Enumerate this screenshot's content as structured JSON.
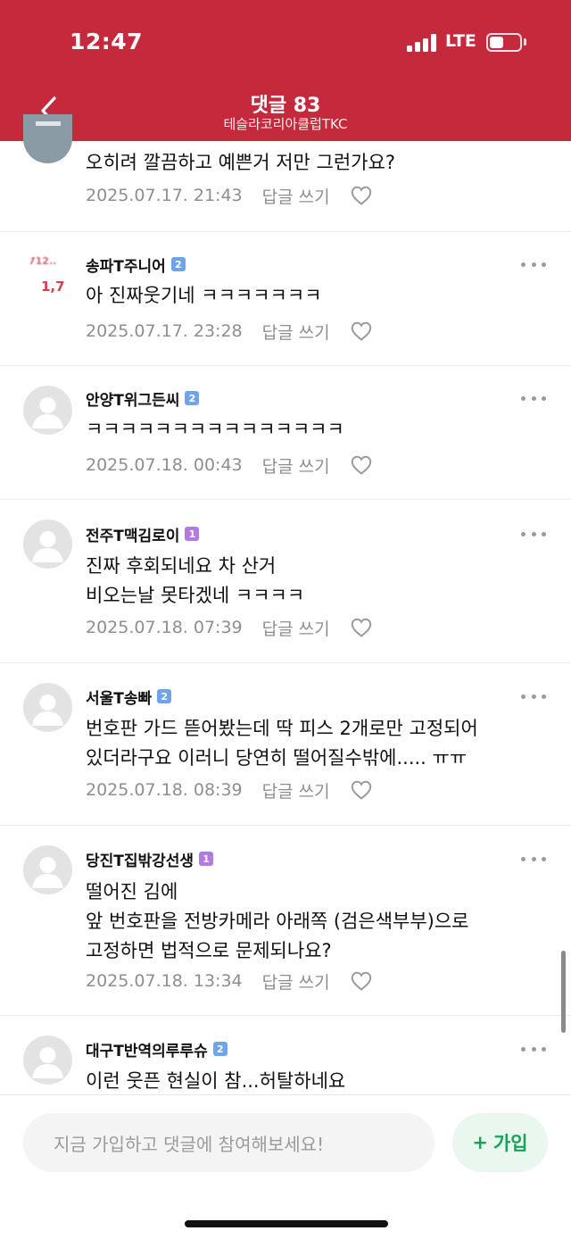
{
  "status_bar": {
    "time": "12:47",
    "network": "LTE"
  },
  "header": {
    "title": "댓글 83",
    "subtitle": "테슬라코리아클럽TKC"
  },
  "comments": [
    {
      "text": "오히려 깔끔하고 예쁜거 저만 그런가요?",
      "date": "2025.07.17. 21:43",
      "reply_label": "답글 쓰기"
    },
    {
      "author": "송파T주니어",
      "level": "2",
      "text": "아 진짜웃기네 ㅋㅋㅋㅋㅋㅋㅋ",
      "date": "2025.07.17. 23:28",
      "reply_label": "답글 쓰기",
      "avatar_text_1": "712..",
      "avatar_text_2": "1,7"
    },
    {
      "author": "안양T위그든씨",
      "level": "2",
      "text": "ㅋㅋㅋㅋㅋㅋㅋㅋㅋㅋㅋㅋㅋㅋㅋ",
      "date": "2025.07.18. 00:43",
      "reply_label": "답글 쓰기"
    },
    {
      "author": "전주T맥김로이",
      "level": "1",
      "text": "진짜 후회되네요 차 산거\n비오는날 못타겠네 ㅋㅋㅋㅋ",
      "date": "2025.07.18. 07:39",
      "reply_label": "답글 쓰기"
    },
    {
      "author": "서울T송빠",
      "level": "2",
      "text": "번호판 가드 뜯어봤는데 딱 피스 2개로만 고정되어\n있더라구요 이러니 당연히 떨어질수밖에..... ㅠㅠ",
      "date": "2025.07.18. 08:39",
      "reply_label": "답글 쓰기"
    },
    {
      "author": "당진T집밖강선생",
      "level": "1",
      "text": "떨어진 김에\n앞 번호판을  전방카메라 아래쪽 (검은색부부)으로\n고정하면 법적으로 문제되나요?",
      "date": "2025.07.18. 13:34",
      "reply_label": "답글 쓰기"
    },
    {
      "author": "대구T반역의루루슈",
      "level": "2",
      "text": "이런 웃픈 현실이 참...허탈하네요"
    }
  ],
  "bottom_bar": {
    "input_placeholder": "지금 가입하고 댓글에 참여해보세요!",
    "join_label": "가입",
    "join_icon": "+"
  },
  "colors": {
    "header_bg": "#c42a3c",
    "accent_green": "#19a35a",
    "level_blue": "#6fa4e8",
    "level_purple": "#b27be0"
  }
}
